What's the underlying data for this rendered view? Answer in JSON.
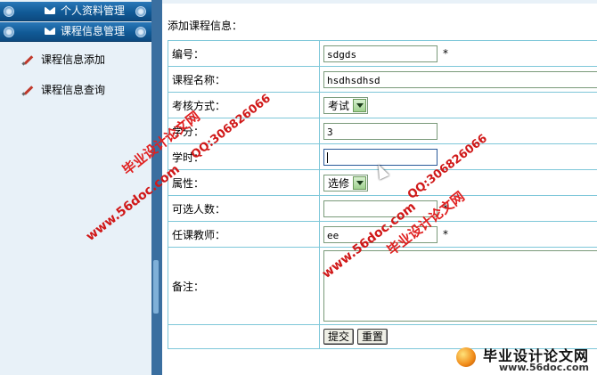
{
  "sidebar": {
    "menus": [
      {
        "label": "个人资料管理"
      },
      {
        "label": "课程信息管理"
      }
    ],
    "links": [
      {
        "label": "课程信息添加"
      },
      {
        "label": "课程信息查询"
      }
    ]
  },
  "main": {
    "title": "添加课程信息：",
    "fields": {
      "code": {
        "label": "编号：",
        "value": "sdgds",
        "required": "*"
      },
      "name": {
        "label": "课程名称：",
        "value": "hsdhsdhsd"
      },
      "exam": {
        "label": "考核方式：",
        "value": "考试"
      },
      "credit": {
        "label": "学分：",
        "value": "3"
      },
      "hours": {
        "label": "学时：",
        "value": ""
      },
      "attr": {
        "label": "属性：",
        "value": "选修"
      },
      "capacity": {
        "label": "可选人数：",
        "value": "",
        "required": "*"
      },
      "teacher": {
        "label": "任课教师：",
        "value": "ee",
        "required": "*"
      },
      "notes": {
        "label": "备注：",
        "value": ""
      }
    },
    "buttons": {
      "submit": "提交",
      "reset": "重置"
    }
  },
  "watermarks": {
    "red_title": "毕业设计论文网",
    "url": "www.56doc.com",
    "qq": "QQ:306826066",
    "logo_name": "毕业设计论文网",
    "logo_site": "www.56doc.com"
  }
}
